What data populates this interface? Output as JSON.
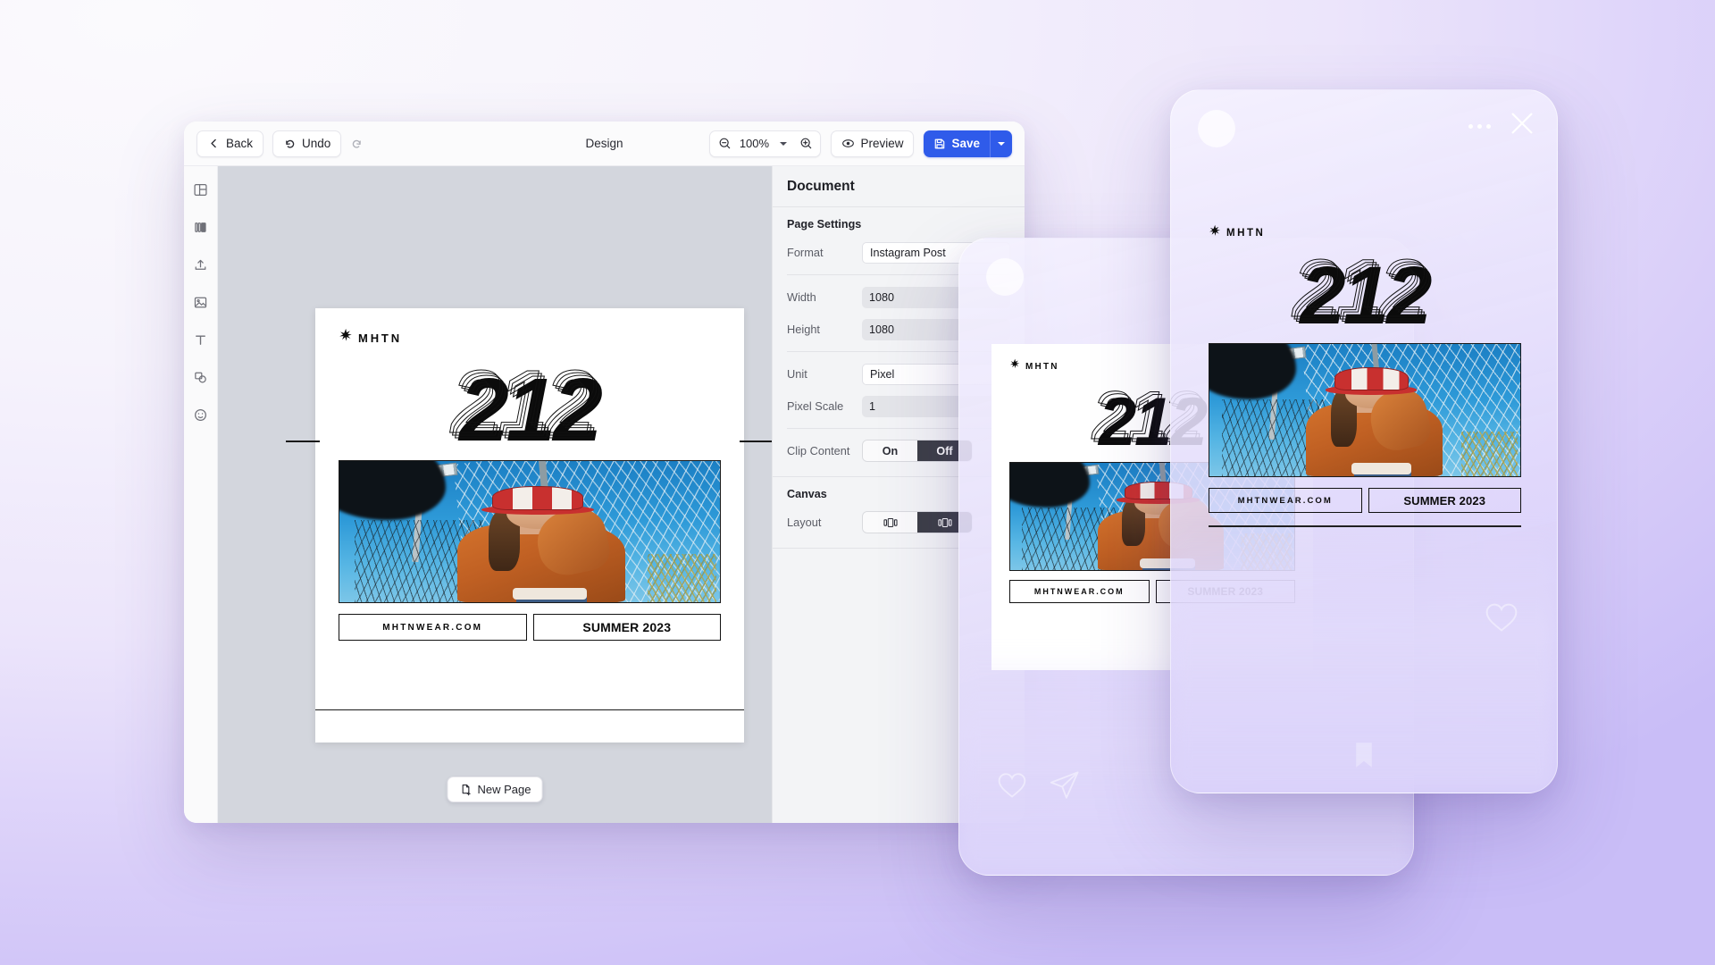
{
  "app": {
    "background_top": "#faf9fc",
    "background_bottom": "#c9bdf7",
    "accent": "#2f5bea"
  },
  "toolbar": {
    "back_label": "Back",
    "undo_label": "Undo",
    "redo_label": "",
    "title": "Design",
    "zoom_value": "100%",
    "zoom_out_icon": "zoom-out-icon",
    "zoom_in_icon": "zoom-in-icon",
    "preview_label": "Preview",
    "save_label": "Save"
  },
  "tool_rail": {
    "items": [
      {
        "name": "layout-icon",
        "label": "Layout"
      },
      {
        "name": "layers-icon",
        "label": "Layers"
      },
      {
        "name": "upload-icon",
        "label": "Upload"
      },
      {
        "name": "image-icon",
        "label": "Image"
      },
      {
        "name": "text-icon",
        "label": "Text"
      },
      {
        "name": "shapes-icon",
        "label": "Shapes"
      },
      {
        "name": "sticker-icon",
        "label": "Stickers"
      }
    ]
  },
  "canvas": {
    "new_page_label": "New Page"
  },
  "inspector": {
    "title": "Document",
    "page_settings": {
      "title": "Page Settings",
      "fields": [
        {
          "label": "Format",
          "value": "Instagram Post",
          "kind": "select"
        },
        {
          "label": "Width",
          "value": "1080",
          "kind": "input"
        },
        {
          "label": "Height",
          "value": "1080",
          "kind": "input"
        },
        {
          "label": "Unit",
          "value": "Pixel",
          "kind": "select"
        },
        {
          "label": "Pixel Scale",
          "value": "1",
          "kind": "input"
        }
      ],
      "clip_content": {
        "label": "Clip Content",
        "options": [
          "On",
          "Off"
        ],
        "selected": "Off"
      }
    },
    "canvas_section": {
      "title": "Canvas",
      "layout": {
        "label": "Layout",
        "options": [
          "grid-layout-icon",
          "stack-layout-icon"
        ],
        "selected": "stack-layout-icon"
      }
    }
  },
  "design": {
    "brand": "MHTN",
    "brand_mark": "star-logo-icon",
    "headline": "212",
    "url_tag": "MHTNWEAR.COM",
    "season_tag": "SUMMER 2023",
    "photo_alt": "woman-in-orange-jacket-and-bucket-hat-by-chain-link-fence"
  },
  "phone_preview": {
    "menu_icon": "more-options-icon",
    "close_icon": "close-icon",
    "avatar_icon": "avatar",
    "actions": [
      "heart-icon",
      "share-icon",
      "bookmark-icon"
    ]
  }
}
